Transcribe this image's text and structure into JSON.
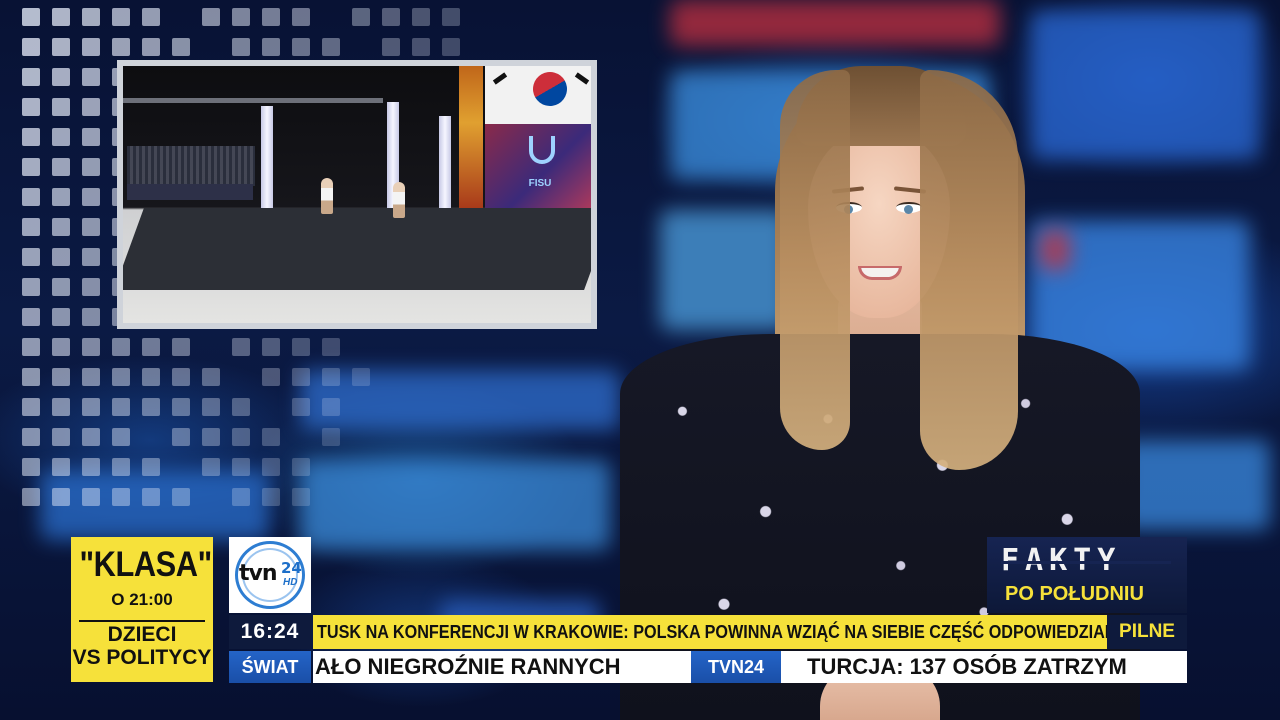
{
  "promo": {
    "title": "\"KLASA\"",
    "time": "O 21:00",
    "subtitle_line1": "DZIECI",
    "subtitle_line2": "VS POLITYCY",
    "color": "#f6e13a"
  },
  "channel_logo": {
    "name": "tvn",
    "number": "24",
    "hd": "HD",
    "accent": "#1d6fc9"
  },
  "program_logo": {
    "title": "FAKTY",
    "subtitle": "PO POŁUDNIU"
  },
  "lower_third": {
    "clock": "16:24",
    "headline": "TUSK NA KONFERENCJI W KRAKOWIE: POLSKA POWINNA WZIĄĆ NA SIEBIE CZĘŚĆ ODPOWIEDZIALNOŚCI ZA TRWAŁOŚĆ UE",
    "urgent_label": "PILNE",
    "section": "ŚWIAT",
    "ticker_items": [
      "AŁO NIEGROŹNIE RANNYCH",
      "TURCJA: 137 OSÓB ZATRZYM"
    ],
    "ticker_brand": "TVN24"
  },
  "inset_video": {
    "screen_text": "FISU"
  }
}
